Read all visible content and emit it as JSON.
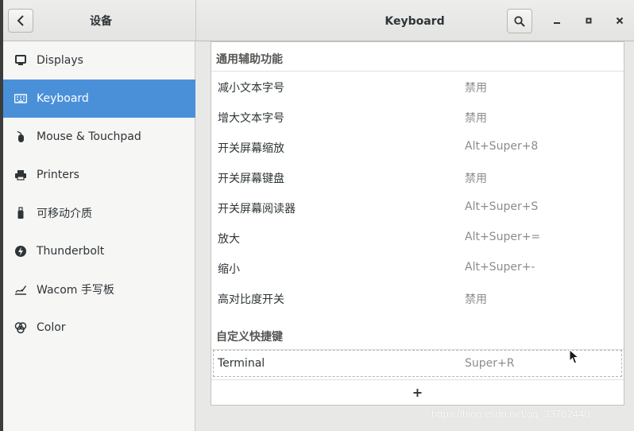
{
  "header": {
    "left_title": "设备",
    "main_title": "Keyboard",
    "back_icon": "back-chevron-icon",
    "search_icon": "search-icon",
    "minimize_label": "–",
    "maximize_label": "▫",
    "close_label": "✕"
  },
  "sidebar": {
    "items": [
      {
        "label": "Displays",
        "icon": "display-icon",
        "selected": false
      },
      {
        "label": "Keyboard",
        "icon": "keyboard-icon",
        "selected": true
      },
      {
        "label": "Mouse & Touchpad",
        "icon": "mouse-icon",
        "selected": false
      },
      {
        "label": "Printers",
        "icon": "printer-icon",
        "selected": false
      },
      {
        "label": "可移动介质",
        "icon": "usb-drive-icon",
        "selected": false
      },
      {
        "label": "Thunderbolt",
        "icon": "thunderbolt-icon",
        "selected": false
      },
      {
        "label": "Wacom 手写板",
        "icon": "tablet-pen-icon",
        "selected": false
      },
      {
        "label": "Color",
        "icon": "color-icon",
        "selected": false
      }
    ]
  },
  "main": {
    "section1_title": "通用辅助功能",
    "shortcuts": [
      {
        "name": "减小文本字号",
        "accel": "禁用"
      },
      {
        "name": "增大文本字号",
        "accel": "禁用"
      },
      {
        "name": "开关屏幕缩放",
        "accel": "Alt+Super+8"
      },
      {
        "name": "开关屏幕键盘",
        "accel": "禁用"
      },
      {
        "name": "开关屏幕阅读器",
        "accel": "Alt+Super+S"
      },
      {
        "name": "放大",
        "accel": "Alt+Super+="
      },
      {
        "name": "缩小",
        "accel": "Alt+Super+-"
      },
      {
        "name": "高对比度开关",
        "accel": "禁用"
      }
    ],
    "section2_title": "自定义快捷键",
    "custom_shortcuts": [
      {
        "name": "Terminal",
        "accel": "Super+R"
      }
    ],
    "add_label": "+"
  },
  "watermark": "https://blog.csdn.net/qq_33762440",
  "colors": {
    "accent": "#4a90d9"
  }
}
